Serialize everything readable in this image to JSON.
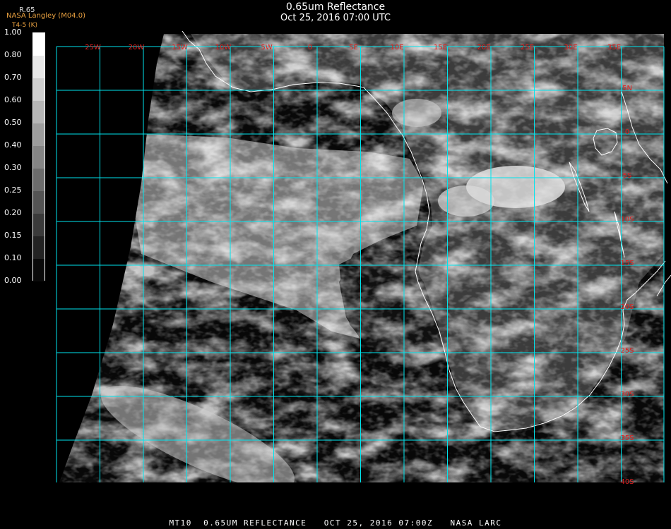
{
  "header": {
    "title": "0.65um Reflectance",
    "timestamp": "Oct 25, 2016 07:00 UTC",
    "credit": "NASA Langley (M04.0)",
    "credit_sub": "T4-5 (K)",
    "colorbar_label": "R.65"
  },
  "colorbar": {
    "ticks": [
      "1.00",
      "0.80",
      "0.70",
      "0.60",
      "0.50",
      "0.40",
      "0.30",
      "0.25",
      "0.20",
      "0.15",
      "0.10",
      "0.00"
    ]
  },
  "map": {
    "longitude_labels": [
      "25W",
      "20W",
      "15W",
      "10W",
      "5W",
      "0",
      "5E",
      "10E",
      "15E",
      "20E",
      "25E",
      "30E",
      "35E"
    ],
    "latitude_labels": [
      "5N",
      "0",
      "5S",
      "10S",
      "15S",
      "20S",
      "25S",
      "30S",
      "35S",
      "40S"
    ],
    "colors": {
      "grid": "#00e5ee",
      "coastline": "#ffffff",
      "label": "#e02020",
      "ocean": "#080808",
      "land": "#3a3a3a",
      "cloud": "#d8d8d8"
    }
  },
  "footer": {
    "text": "MT10  0.65UM REFLECTANCE   OCT 25, 2016 07:00Z   NASA LARC"
  }
}
